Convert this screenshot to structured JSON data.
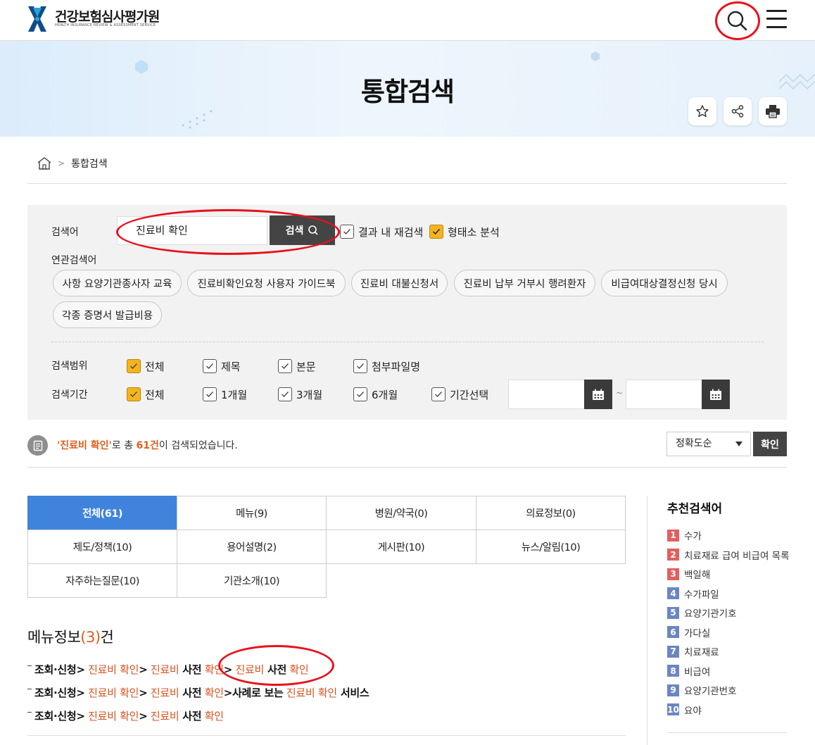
{
  "header": {
    "org_name": "건강보험심사평가원",
    "org_name_en": "HEALTH INSURANCE REVIEW & ASSESSMENT SERVICE"
  },
  "banner": {
    "title": "통합검색"
  },
  "breadcrumb": {
    "current": "통합검색"
  },
  "search": {
    "label": "검색어",
    "value": "진료비 확인",
    "button_label": "검색",
    "research_label": "결과 내 재검색",
    "research_checked": false,
    "morph_label": "형태소 분석",
    "morph_checked": true,
    "related_label": "연관검색어",
    "related": [
      "사항 요양기관종사자 교육",
      "진료비확인요청 사용자 가이드북",
      "진료비 대불신청서",
      "진료비 납부 거부시 행려환자",
      "비급여대상결정신청 당시",
      "각종 증명서 발급비용"
    ]
  },
  "scope": {
    "label": "검색범위",
    "options": [
      {
        "label": "전체",
        "checked": true
      },
      {
        "label": "제목",
        "checked": false
      },
      {
        "label": "본문",
        "checked": false
      },
      {
        "label": "첨부파일명",
        "checked": false
      }
    ]
  },
  "period": {
    "label": "검색기간",
    "options": [
      {
        "label": "전체",
        "checked": true
      },
      {
        "label": "1개월",
        "checked": false
      },
      {
        "label": "3개월",
        "checked": false
      },
      {
        "label": "6개월",
        "checked": false
      },
      {
        "label": "기간선택",
        "checked": false
      }
    ],
    "date_sep": "~"
  },
  "result_summary": {
    "query": "'진료비 확인'",
    "mid": "로 총 ",
    "count": "61건",
    "tail": "이 검색되었습니다."
  },
  "sort": {
    "selected": "정확도순",
    "confirm_label": "확인"
  },
  "tabs": [
    "전체(61)",
    "메뉴(9)",
    "병원/약국(0)",
    "의료정보(0)",
    "제도/정책(10)",
    "용어설명(2)",
    "게시판(10)",
    "뉴스/알림(10)",
    "자주하는질문(10)",
    "기관소개(10)"
  ],
  "menu_info": {
    "title": "메뉴정보",
    "count": "(3)",
    "suffix": "건",
    "rows": [
      [
        {
          "t": "조회·신청>",
          "s": "b"
        },
        {
          "t": " 진료비 확인",
          "s": "o"
        },
        {
          "t": ">",
          "s": "b"
        },
        {
          "t": " 진료비",
          "s": "o"
        },
        {
          "t": " 사전",
          "s": "b"
        },
        {
          "t": " 확인",
          "s": "o"
        },
        {
          "t": ">",
          "s": "b"
        },
        {
          "t": " 진료비",
          "s": "o"
        },
        {
          "t": " 사전",
          "s": "b"
        },
        {
          "t": " 확인",
          "s": "o"
        }
      ],
      [
        {
          "t": "조회·신청>",
          "s": "b"
        },
        {
          "t": " 진료비 확인",
          "s": "o"
        },
        {
          "t": ">",
          "s": "b"
        },
        {
          "t": " 진료비",
          "s": "o"
        },
        {
          "t": " 사전",
          "s": "b"
        },
        {
          "t": " 확인",
          "s": "o"
        },
        {
          "t": ">사례로 보는",
          "s": "b"
        },
        {
          "t": " 진료비 확인",
          "s": "o"
        },
        {
          "t": " 서비스",
          "s": "b"
        }
      ],
      [
        {
          "t": "조회·신청>",
          "s": "b"
        },
        {
          "t": " 진료비 확인",
          "s": "o"
        },
        {
          "t": ">",
          "s": "b"
        },
        {
          "t": " 진료비",
          "s": "o"
        },
        {
          "t": " 사전",
          "s": "b"
        },
        {
          "t": " 확인",
          "s": "o"
        }
      ]
    ]
  },
  "recommended": {
    "title": "추천검색어",
    "items": [
      {
        "rank": "1",
        "label": "수가"
      },
      {
        "rank": "2",
        "label": "치료재료 급여 비급여 목록"
      },
      {
        "rank": "3",
        "label": "백일해"
      },
      {
        "rank": "4",
        "label": "수가파일"
      },
      {
        "rank": "5",
        "label": "요양기관기호"
      },
      {
        "rank": "6",
        "label": "가다실"
      },
      {
        "rank": "7",
        "label": "치료재료"
      },
      {
        "rank": "8",
        "label": "비급여"
      },
      {
        "rank": "9",
        "label": "요양기관번호"
      },
      {
        "rank": "10",
        "label": "요야"
      }
    ]
  },
  "colors": {
    "accent": "#3f83dc",
    "highlight": "#e05d1b",
    "check": "#f5b41e",
    "annotation": "#e8111b"
  }
}
